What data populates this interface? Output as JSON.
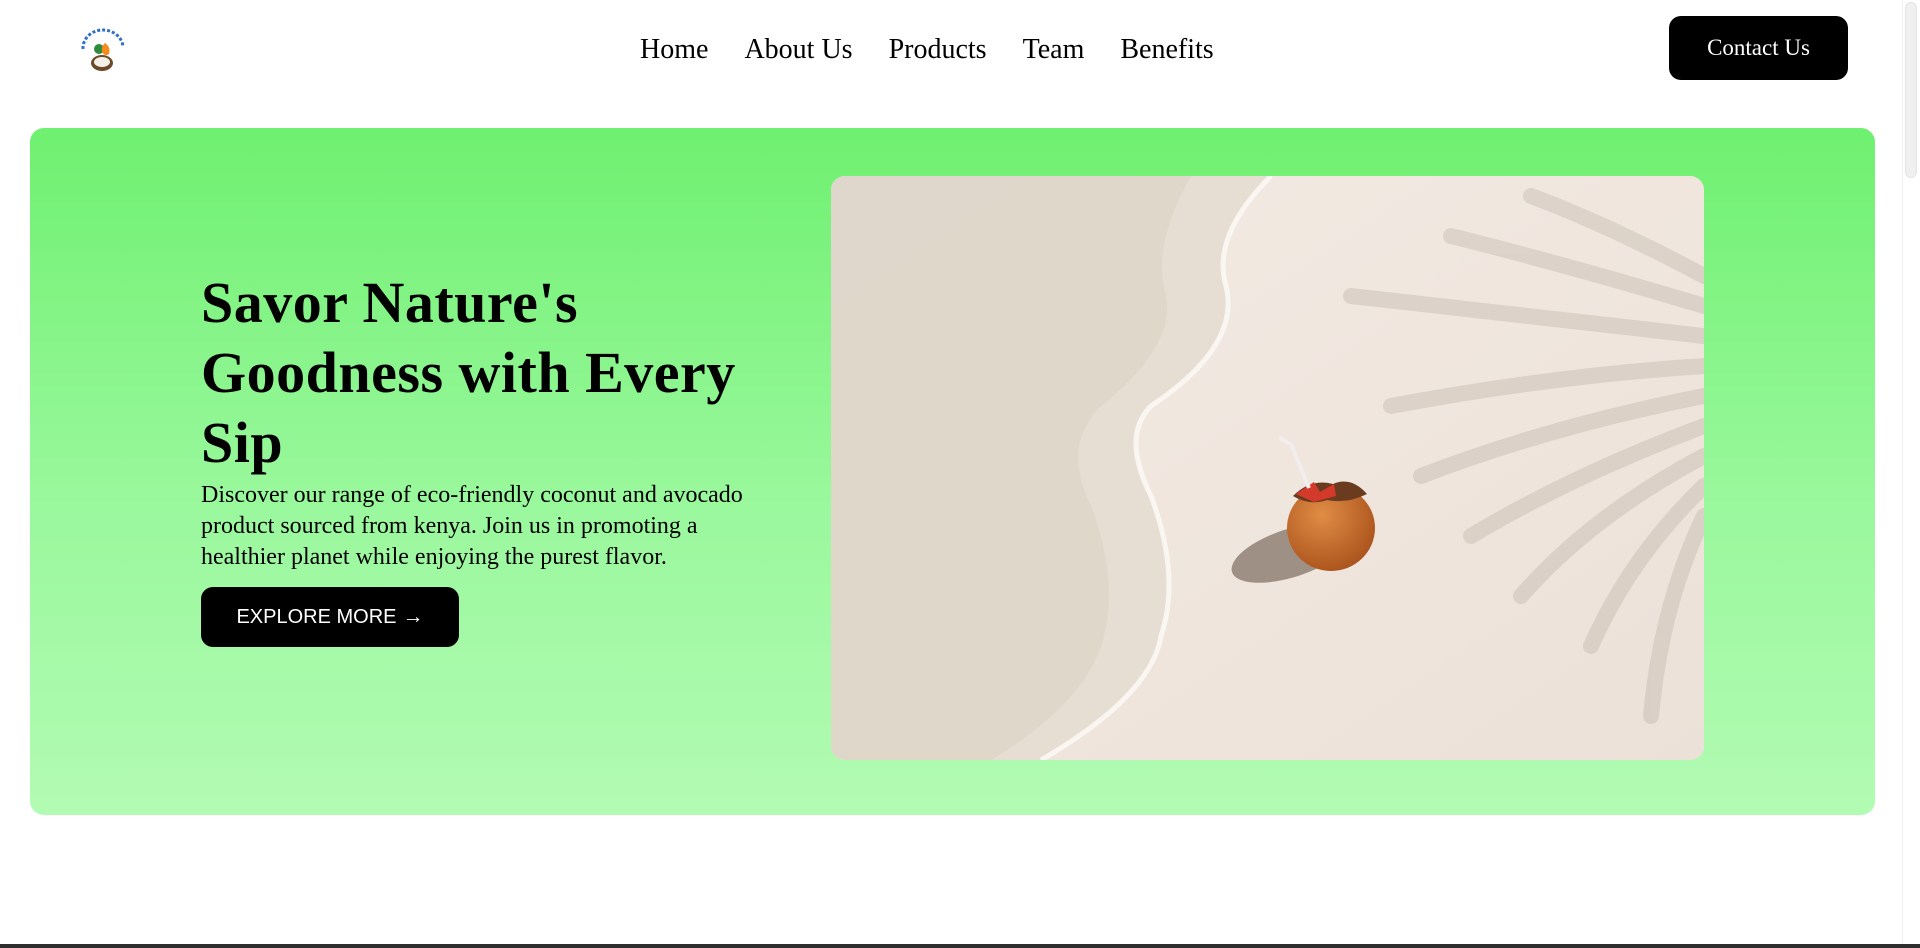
{
  "nav": {
    "links": [
      {
        "label": "Home"
      },
      {
        "label": "About Us"
      },
      {
        "label": "Products"
      },
      {
        "label": "Team"
      },
      {
        "label": "Benefits"
      }
    ],
    "contact_label": "Contact Us",
    "logo_icon": "coconut-avocado-logo-icon"
  },
  "hero": {
    "title": "Savor Nature's Goodness with Every Sip",
    "description": "Discover our range of eco-friendly coconut and avocado product sourced from kenya. Join us in promoting a healthier planet while enjoying the purest flavor.",
    "cta_label": "EXPLORE MORE",
    "cta_arrow": "→",
    "image_icon": "coconut-on-beach-photo"
  },
  "colors": {
    "hero_gradient_top": "#6ff070",
    "hero_gradient_bottom": "#b2fbb3",
    "button": "#000000",
    "button_text": "#ffffff"
  }
}
